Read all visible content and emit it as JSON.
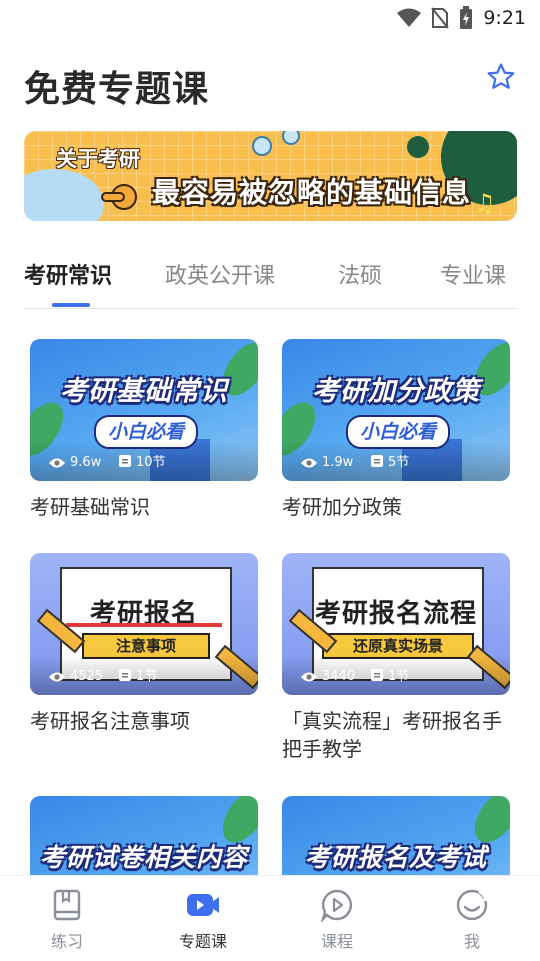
{
  "status_bar": {
    "time": "9:21"
  },
  "header": {
    "title": "免费专题课"
  },
  "banner": {
    "kicker": "关于考研",
    "headline": "最容易被忽略的基础信息"
  },
  "tabs": [
    {
      "label": "考研常识"
    },
    {
      "label": "政英公开课"
    },
    {
      "label": "法硕"
    },
    {
      "label": "专业课"
    }
  ],
  "courses": [
    {
      "thumb_title": "考研基础常识",
      "thumb_sub": "小白必看",
      "views": "9.6w",
      "lessons": "10节",
      "title": "考研基础常识"
    },
    {
      "thumb_title": "考研加分政策",
      "thumb_sub": "小白必看",
      "views": "1.9w",
      "lessons": "5节",
      "title": "考研加分政策"
    },
    {
      "thumb_title": "考研报名",
      "thumb_sub": "注意事项",
      "views": "4525",
      "lessons": "1节",
      "title": "考研报名注意事项"
    },
    {
      "thumb_title": "考研报名流程",
      "thumb_sub": "还原真实场景",
      "views": "3440",
      "lessons": "1节",
      "title": "「真实流程」考研报名手把手教学"
    },
    {
      "thumb_title": "考研试卷相关内容"
    },
    {
      "thumb_title": "考研报名及考试"
    }
  ],
  "bottom_nav": [
    {
      "label": "练习",
      "icon": "book-icon"
    },
    {
      "label": "专题课",
      "icon": "video-icon"
    },
    {
      "label": "课程",
      "icon": "play-bubble-icon"
    },
    {
      "label": "我",
      "icon": "smile-icon"
    }
  ],
  "colors": {
    "accent": "#3f6ff0",
    "tab_inactive": "#888888",
    "nav_inactive": "#8a8f99"
  }
}
